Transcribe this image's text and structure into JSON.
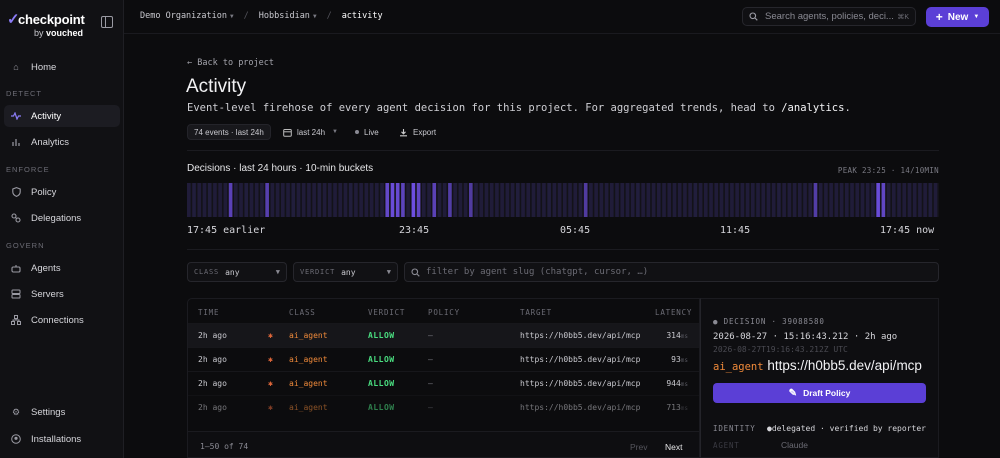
{
  "brand": {
    "name": "checkpoint",
    "by": "by",
    "by_name": "vouched",
    "mark": "✓"
  },
  "sidebar": {
    "home": "Home",
    "sections": [
      "DETECT",
      "ENFORCE",
      "GOVERN"
    ],
    "items": [
      {
        "label": "Activity",
        "icon": "activity-icon"
      },
      {
        "label": "Analytics",
        "icon": "bar-chart-icon"
      },
      {
        "label": "Policy",
        "icon": "shield-icon"
      },
      {
        "label": "Delegations",
        "icon": "link-icon"
      },
      {
        "label": "Agents",
        "icon": "bot-icon"
      },
      {
        "label": "Servers",
        "icon": "server-icon"
      },
      {
        "label": "Connections",
        "icon": "network-icon"
      }
    ],
    "settings": "Settings",
    "installations": "Installations",
    "active": "Activity"
  },
  "topbar": {
    "org": "Demo Organization",
    "project": "Hobbsidian",
    "page": "activity",
    "search_placeholder": "Search agents, policies, deci...",
    "search_shortcut": "⌘K",
    "new_label": "New"
  },
  "page": {
    "back": "Back to project",
    "title": "Activity",
    "subtitle_prefix": "Event-level firehose of every agent decision for this project. For aggregated trends, head to ",
    "subtitle_link": "/analytics",
    "subtitle_suffix": ".",
    "events_chip": "74 events · last 24h",
    "range": "last 24h",
    "live": "Live",
    "export": "Export"
  },
  "chart_data": {
    "type": "bar",
    "title": "Decisions · last 24 hours · 10-min buckets",
    "peak": "PEAK 23:25 · 14/10MIN",
    "x_ticks": [
      "17:45 earlier",
      "23:45",
      "05:45",
      "11:45",
      "17:45 now"
    ],
    "bucket_count": 144,
    "values": [
      2,
      3,
      2,
      2,
      3,
      2,
      2,
      2,
      8,
      2,
      2,
      3,
      2,
      2,
      2,
      7,
      2,
      2,
      2,
      2,
      3,
      2,
      2,
      2,
      2,
      3,
      2,
      2,
      2,
      2,
      2,
      3,
      2,
      2,
      2,
      2,
      2,
      2,
      11,
      13,
      12,
      9,
      2,
      14,
      10,
      2,
      2,
      8,
      2,
      2,
      6,
      2,
      2,
      2,
      5,
      2,
      2,
      2,
      2,
      2,
      2,
      2,
      2,
      3,
      2,
      2,
      2,
      2,
      2,
      3,
      2,
      2,
      2,
      2,
      2,
      2,
      5,
      2,
      2,
      2,
      2,
      2,
      2,
      2,
      2,
      2,
      4,
      2,
      2,
      2,
      2,
      2,
      2,
      2,
      2,
      2,
      2,
      3,
      2,
      2,
      2,
      2,
      2,
      2,
      2,
      2,
      2,
      2,
      2,
      2,
      2,
      2,
      2,
      3,
      2,
      2,
      2,
      2,
      2,
      2,
      6,
      2,
      2,
      2,
      2,
      2,
      2,
      2,
      2,
      2,
      2,
      2,
      13,
      10,
      2,
      2,
      2,
      2,
      2,
      2,
      2,
      2,
      3,
      2
    ],
    "ylim": [
      0,
      14
    ],
    "color_low": "#2a2553",
    "color_high": "#6d4fe0"
  },
  "filters": {
    "class_label": "CLASS",
    "class_value": "any",
    "verdict_label": "VERDICT",
    "verdict_value": "any",
    "search_placeholder": "filter by agent slug (chatgpt, cursor, …)"
  },
  "table": {
    "columns": [
      "TIME",
      "CLASS",
      "VERDICT",
      "POLICY",
      "TARGET",
      "LATENCY"
    ],
    "rows": [
      {
        "time": "2h ago",
        "class": "ai_agent",
        "verdict": "ALLOW",
        "policy": "–",
        "target": "https://h0bb5.dev/api/mcp",
        "latency": "314",
        "unit": "ms"
      },
      {
        "time": "2h ago",
        "class": "ai_agent",
        "verdict": "ALLOW",
        "policy": "–",
        "target": "https://h0bb5.dev/api/mcp",
        "latency": "93",
        "unit": "ms"
      },
      {
        "time": "2h ago",
        "class": "ai_agent",
        "verdict": "ALLOW",
        "policy": "–",
        "target": "https://h0bb5.dev/api/mcp",
        "latency": "944",
        "unit": "ms"
      },
      {
        "time": "2h ago",
        "class": "ai_agent",
        "verdict": "ALLOW",
        "policy": "–",
        "target": "https://h0bb5.dev/api/mcp",
        "latency": "713",
        "unit": "ms"
      }
    ],
    "pager": "1–50 of 74",
    "prev": "Prev",
    "next": "Next"
  },
  "detail": {
    "tag": "DECISION · 39088580",
    "time": "2026-08-27 · 15:16:43.212 · 2h ago",
    "iso": "2026-08-27T19:16:43.212Z UTC",
    "agent": "ai_agent",
    "target": "https://h0bb5.dev/api/mcp",
    "draft": "Draft Policy",
    "identity_label": "IDENTITY",
    "identity_value": "delegated · verified by reporter",
    "agent_label": "AGENT",
    "agent_value": "Claude"
  }
}
